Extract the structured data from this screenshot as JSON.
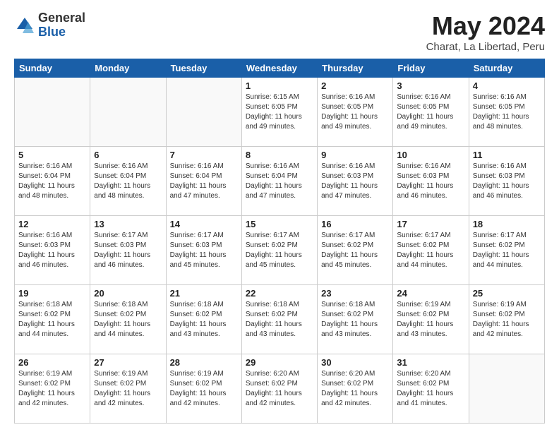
{
  "header": {
    "logo_general": "General",
    "logo_blue": "Blue",
    "month_title": "May 2024",
    "location": "Charat, La Libertad, Peru"
  },
  "weekdays": [
    "Sunday",
    "Monday",
    "Tuesday",
    "Wednesday",
    "Thursday",
    "Friday",
    "Saturday"
  ],
  "weeks": [
    [
      {
        "day": "",
        "info": ""
      },
      {
        "day": "",
        "info": ""
      },
      {
        "day": "",
        "info": ""
      },
      {
        "day": "1",
        "info": "Sunrise: 6:15 AM\nSunset: 6:05 PM\nDaylight: 11 hours\nand 49 minutes."
      },
      {
        "day": "2",
        "info": "Sunrise: 6:16 AM\nSunset: 6:05 PM\nDaylight: 11 hours\nand 49 minutes."
      },
      {
        "day": "3",
        "info": "Sunrise: 6:16 AM\nSunset: 6:05 PM\nDaylight: 11 hours\nand 49 minutes."
      },
      {
        "day": "4",
        "info": "Sunrise: 6:16 AM\nSunset: 6:05 PM\nDaylight: 11 hours\nand 48 minutes."
      }
    ],
    [
      {
        "day": "5",
        "info": "Sunrise: 6:16 AM\nSunset: 6:04 PM\nDaylight: 11 hours\nand 48 minutes."
      },
      {
        "day": "6",
        "info": "Sunrise: 6:16 AM\nSunset: 6:04 PM\nDaylight: 11 hours\nand 48 minutes."
      },
      {
        "day": "7",
        "info": "Sunrise: 6:16 AM\nSunset: 6:04 PM\nDaylight: 11 hours\nand 47 minutes."
      },
      {
        "day": "8",
        "info": "Sunrise: 6:16 AM\nSunset: 6:04 PM\nDaylight: 11 hours\nand 47 minutes."
      },
      {
        "day": "9",
        "info": "Sunrise: 6:16 AM\nSunset: 6:03 PM\nDaylight: 11 hours\nand 47 minutes."
      },
      {
        "day": "10",
        "info": "Sunrise: 6:16 AM\nSunset: 6:03 PM\nDaylight: 11 hours\nand 46 minutes."
      },
      {
        "day": "11",
        "info": "Sunrise: 6:16 AM\nSunset: 6:03 PM\nDaylight: 11 hours\nand 46 minutes."
      }
    ],
    [
      {
        "day": "12",
        "info": "Sunrise: 6:16 AM\nSunset: 6:03 PM\nDaylight: 11 hours\nand 46 minutes."
      },
      {
        "day": "13",
        "info": "Sunrise: 6:17 AM\nSunset: 6:03 PM\nDaylight: 11 hours\nand 46 minutes."
      },
      {
        "day": "14",
        "info": "Sunrise: 6:17 AM\nSunset: 6:03 PM\nDaylight: 11 hours\nand 45 minutes."
      },
      {
        "day": "15",
        "info": "Sunrise: 6:17 AM\nSunset: 6:02 PM\nDaylight: 11 hours\nand 45 minutes."
      },
      {
        "day": "16",
        "info": "Sunrise: 6:17 AM\nSunset: 6:02 PM\nDaylight: 11 hours\nand 45 minutes."
      },
      {
        "day": "17",
        "info": "Sunrise: 6:17 AM\nSunset: 6:02 PM\nDaylight: 11 hours\nand 44 minutes."
      },
      {
        "day": "18",
        "info": "Sunrise: 6:17 AM\nSunset: 6:02 PM\nDaylight: 11 hours\nand 44 minutes."
      }
    ],
    [
      {
        "day": "19",
        "info": "Sunrise: 6:18 AM\nSunset: 6:02 PM\nDaylight: 11 hours\nand 44 minutes."
      },
      {
        "day": "20",
        "info": "Sunrise: 6:18 AM\nSunset: 6:02 PM\nDaylight: 11 hours\nand 44 minutes."
      },
      {
        "day": "21",
        "info": "Sunrise: 6:18 AM\nSunset: 6:02 PM\nDaylight: 11 hours\nand 43 minutes."
      },
      {
        "day": "22",
        "info": "Sunrise: 6:18 AM\nSunset: 6:02 PM\nDaylight: 11 hours\nand 43 minutes."
      },
      {
        "day": "23",
        "info": "Sunrise: 6:18 AM\nSunset: 6:02 PM\nDaylight: 11 hours\nand 43 minutes."
      },
      {
        "day": "24",
        "info": "Sunrise: 6:19 AM\nSunset: 6:02 PM\nDaylight: 11 hours\nand 43 minutes."
      },
      {
        "day": "25",
        "info": "Sunrise: 6:19 AM\nSunset: 6:02 PM\nDaylight: 11 hours\nand 42 minutes."
      }
    ],
    [
      {
        "day": "26",
        "info": "Sunrise: 6:19 AM\nSunset: 6:02 PM\nDaylight: 11 hours\nand 42 minutes."
      },
      {
        "day": "27",
        "info": "Sunrise: 6:19 AM\nSunset: 6:02 PM\nDaylight: 11 hours\nand 42 minutes."
      },
      {
        "day": "28",
        "info": "Sunrise: 6:19 AM\nSunset: 6:02 PM\nDaylight: 11 hours\nand 42 minutes."
      },
      {
        "day": "29",
        "info": "Sunrise: 6:20 AM\nSunset: 6:02 PM\nDaylight: 11 hours\nand 42 minutes."
      },
      {
        "day": "30",
        "info": "Sunrise: 6:20 AM\nSunset: 6:02 PM\nDaylight: 11 hours\nand 42 minutes."
      },
      {
        "day": "31",
        "info": "Sunrise: 6:20 AM\nSunset: 6:02 PM\nDaylight: 11 hours\nand 41 minutes."
      },
      {
        "day": "",
        "info": ""
      }
    ]
  ]
}
